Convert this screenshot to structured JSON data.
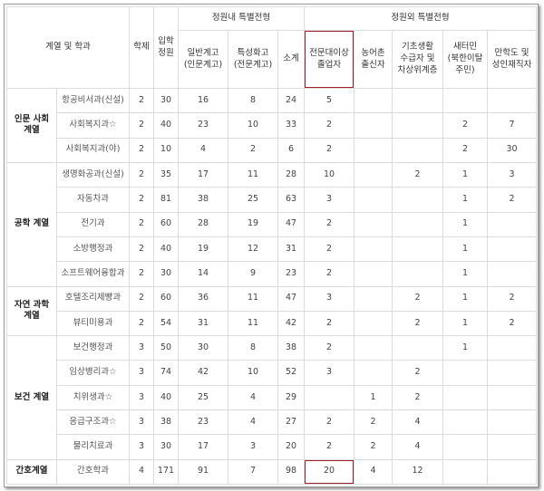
{
  "header": {
    "dept_col": "계열 및 학과",
    "hakje": "학제",
    "ipak": "입학\n정원",
    "naegroup": "정원내 특별전형",
    "oegroup": "정원외 특별전형",
    "ilban": "일반계고\n(인문계고)",
    "teukseong": "특성화고\n(전문계고)",
    "sogye": "소계",
    "jeonmun": "전문대이상\n졸업자",
    "nongeo": "농어촌\n출신자",
    "gicho": "기초생활\n수급자 및\n차상위계층",
    "saeteomin": "새터민\n(북한이탈\n주민)",
    "manhakdo": "만학도 및\n성인재직자"
  },
  "groups": [
    {
      "name": "인문 사회\n계열",
      "rows": [
        {
          "dept": "항공비서과(신설)",
          "hakje": "2",
          "ipak": "30",
          "ilban": "16",
          "teuk": "8",
          "sogye": "24",
          "jeonmun": "5",
          "nong": "",
          "gicho": "",
          "saet": "",
          "manh": ""
        },
        {
          "dept": "사회복지과☆",
          "hakje": "2",
          "ipak": "40",
          "ilban": "23",
          "teuk": "10",
          "sogye": "33",
          "jeonmun": "2",
          "nong": "",
          "gicho": "",
          "saet": "2",
          "manh": "7"
        },
        {
          "dept": "사회복지과(야)",
          "hakje": "2",
          "ipak": "10",
          "ilban": "4",
          "teuk": "2",
          "sogye": "6",
          "jeonmun": "2",
          "nong": "",
          "gicho": "",
          "saet": "2",
          "manh": "30"
        }
      ]
    },
    {
      "name": "공학 계열",
      "rows": [
        {
          "dept": "생명화공과(신설)",
          "hakje": "2",
          "ipak": "35",
          "ilban": "17",
          "teuk": "11",
          "sogye": "28",
          "jeonmun": "10",
          "nong": "",
          "gicho": "2",
          "saet": "1",
          "manh": "3"
        },
        {
          "dept": "자동차과",
          "hakje": "2",
          "ipak": "81",
          "ilban": "38",
          "teuk": "25",
          "sogye": "63",
          "jeonmun": "3",
          "nong": "",
          "gicho": "",
          "saet": "1",
          "manh": "2"
        },
        {
          "dept": "전기과",
          "hakje": "2",
          "ipak": "60",
          "ilban": "28",
          "teuk": "19",
          "sogye": "47",
          "jeonmun": "2",
          "nong": "",
          "gicho": "",
          "saet": "1",
          "manh": ""
        },
        {
          "dept": "소방행정과",
          "hakje": "2",
          "ipak": "40",
          "ilban": "19",
          "teuk": "12",
          "sogye": "31",
          "jeonmun": "2",
          "nong": "",
          "gicho": "",
          "saet": "1",
          "manh": ""
        },
        {
          "dept": "소프트웨어융합과",
          "hakje": "2",
          "ipak": "30",
          "ilban": "14",
          "teuk": "9",
          "sogye": "23",
          "jeonmun": "2",
          "nong": "",
          "gicho": "",
          "saet": "1",
          "manh": ""
        }
      ]
    },
    {
      "name": "자연 과학\n계열",
      "rows": [
        {
          "dept": "호텔조리제빵과",
          "hakje": "2",
          "ipak": "60",
          "ilban": "36",
          "teuk": "11",
          "sogye": "47",
          "jeonmun": "3",
          "nong": "",
          "gicho": "2",
          "saet": "1",
          "manh": "2"
        },
        {
          "dept": "뷰티미용과",
          "hakje": "2",
          "ipak": "54",
          "ilban": "31",
          "teuk": "11",
          "sogye": "42",
          "jeonmun": "2",
          "nong": "",
          "gicho": "2",
          "saet": "1",
          "manh": "2"
        }
      ]
    },
    {
      "name": "보건 계열",
      "rows": [
        {
          "dept": "보건행정과",
          "hakje": "3",
          "ipak": "50",
          "ilban": "30",
          "teuk": "8",
          "sogye": "38",
          "jeonmun": "2",
          "nong": "",
          "gicho": "",
          "saet": "1",
          "manh": ""
        },
        {
          "dept": "임상병리과☆",
          "hakje": "3",
          "ipak": "74",
          "ilban": "42",
          "teuk": "10",
          "sogye": "52",
          "jeonmun": "3",
          "nong": "",
          "gicho": "2",
          "saet": "",
          "manh": ""
        },
        {
          "dept": "치위생과☆",
          "hakje": "3",
          "ipak": "40",
          "ilban": "25",
          "teuk": "4",
          "sogye": "29",
          "jeonmun": "",
          "nong": "1",
          "gicho": "2",
          "saet": "",
          "manh": ""
        },
        {
          "dept": "응급구조과☆",
          "hakje": "3",
          "ipak": "38",
          "ilban": "23",
          "teuk": "4",
          "sogye": "27",
          "jeonmun": "2",
          "nong": "2",
          "gicho": "4",
          "saet": "",
          "manh": ""
        },
        {
          "dept": "물리치료과",
          "hakje": "3",
          "ipak": "30",
          "ilban": "17",
          "teuk": "3",
          "sogye": "20",
          "jeonmun": "2",
          "nong": "2",
          "gicho": "4",
          "saet": "",
          "manh": ""
        }
      ]
    },
    {
      "name": "간호계열",
      "rows": [
        {
          "dept": "간호학과",
          "hakje": "4",
          "ipak": "171",
          "ilban": "91",
          "teuk": "7",
          "sogye": "98",
          "jeonmun": "20",
          "nong": "4",
          "gicho": "12",
          "saet": "",
          "manh": ""
        }
      ]
    }
  ],
  "highlight_color": "#a21f2b"
}
